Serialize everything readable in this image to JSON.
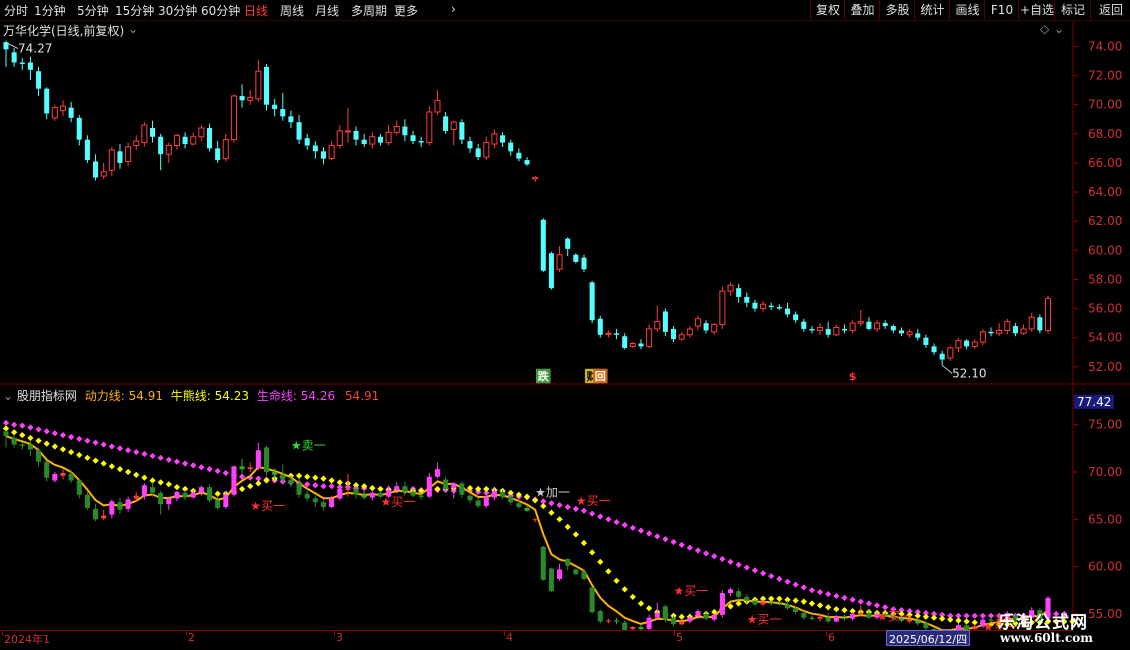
{
  "toolbar": {
    "periods": [
      "分时",
      "1分钟",
      "5分钟",
      "15分钟",
      "30分钟",
      "60分钟",
      "日线",
      "周线",
      "月线",
      "多周期",
      "更多"
    ],
    "active_period": "日线",
    "more_chevron": "›",
    "right_buttons": [
      "复权",
      "叠加",
      "多股",
      "统计",
      "画线",
      "F10",
      "+自选",
      "标记",
      "返回"
    ]
  },
  "main_chart": {
    "title": "万华化学(日线,前复权)",
    "high_label": "74.27",
    "low_label": "52.10",
    "yticks": [
      "74.00",
      "72.00",
      "70.00",
      "68.00",
      "66.00",
      "64.00",
      "62.00",
      "60.00",
      "58.00",
      "56.00",
      "54.00",
      "52.00"
    ],
    "markers": [
      "跌",
      "财",
      "回",
      "$"
    ]
  },
  "indicator": {
    "name": "股朋指标网",
    "dongli_label": "动力线:",
    "dongli_value": "54.91",
    "niuxiong_label": "牛熊线:",
    "niuxiong_value": "54.23",
    "shengming_label": "生命线:",
    "shengming_value": "54.26",
    "extra_value": "54.91",
    "yticks": [
      "75.00",
      "70.00",
      "65.00",
      "60.00",
      "55.00"
    ],
    "current_tag": "77.42",
    "signals": [
      "卖一",
      "买一",
      "买一",
      "加一",
      "买一",
      "买一",
      "买一",
      "买一",
      "买一"
    ]
  },
  "dates": {
    "labels": [
      "2024年1",
      "2",
      "3",
      "4",
      "5",
      "6"
    ],
    "cursor_date": "2025/06/12/四"
  },
  "logo": {
    "line1": "乐淘公式网",
    "line2": "www.60lt.com"
  },
  "colors": {
    "up": "#ff3c3c",
    "down": "#54ffff",
    "dongli": "#ffb000",
    "niuxiong": "#ffff00",
    "shengming": "#ff40ff",
    "axis": "#7a0000"
  },
  "chart_data": {
    "type": "candlestick",
    "ohlc": [
      [
        74.3,
        73.8,
        74.4,
        72.6
      ],
      [
        73.6,
        72.9,
        73.9,
        72.6
      ],
      [
        72.9,
        72.8,
        73.2,
        72.4
      ],
      [
        72.9,
        72.4,
        73.3,
        71.7
      ],
      [
        72.3,
        71.1,
        72.6,
        70.6
      ],
      [
        71.1,
        69.4,
        71.2,
        69.0
      ],
      [
        69.1,
        69.8,
        70.0,
        68.9
      ],
      [
        69.6,
        69.9,
        70.3,
        69.2
      ],
      [
        69.8,
        69.1,
        70.2,
        68.8
      ],
      [
        69.1,
        67.6,
        69.3,
        67.2
      ],
      [
        67.6,
        66.2,
        67.9,
        66.0
      ],
      [
        66.1,
        65.0,
        66.6,
        64.8
      ],
      [
        65.1,
        65.4,
        66.0,
        64.9
      ],
      [
        65.5,
        66.9,
        67.1,
        65.1
      ],
      [
        66.8,
        66.0,
        67.3,
        65.6
      ],
      [
        66.1,
        67.1,
        67.4,
        65.8
      ],
      [
        67.2,
        67.5,
        67.9,
        66.9
      ],
      [
        67.4,
        68.6,
        68.8,
        67.1
      ],
      [
        68.4,
        67.8,
        68.9,
        67.4
      ],
      [
        67.8,
        66.6,
        68.0,
        65.5
      ],
      [
        66.6,
        67.2,
        67.4,
        66.0
      ],
      [
        67.2,
        67.9,
        68.0,
        66.9
      ],
      [
        67.8,
        67.3,
        68.1,
        67.0
      ],
      [
        67.3,
        67.8,
        68.1,
        67.2
      ],
      [
        67.8,
        68.4,
        68.6,
        67.5
      ],
      [
        68.4,
        67.0,
        68.7,
        66.8
      ],
      [
        67.0,
        66.2,
        67.5,
        66.0
      ],
      [
        66.3,
        67.6,
        68.0,
        66.1
      ],
      [
        67.6,
        70.6,
        70.7,
        67.4
      ],
      [
        70.6,
        70.3,
        71.4,
        69.8
      ],
      [
        70.3,
        70.5,
        71.0,
        70.0
      ],
      [
        70.4,
        72.3,
        73.1,
        70.2
      ],
      [
        72.6,
        70.0,
        72.8,
        69.6
      ],
      [
        70.0,
        69.7,
        70.4,
        69.2
      ],
      [
        69.7,
        69.2,
        70.8,
        68.9
      ],
      [
        69.2,
        68.8,
        69.6,
        68.4
      ],
      [
        68.8,
        67.6,
        69.3,
        67.3
      ],
      [
        67.7,
        67.2,
        68.0,
        66.9
      ],
      [
        67.2,
        66.8,
        67.5,
        66.3
      ],
      [
        66.8,
        66.3,
        67.1,
        65.9
      ],
      [
        66.3,
        67.2,
        67.5,
        66.2
      ],
      [
        67.2,
        68.2,
        68.6,
        67.0
      ],
      [
        68.2,
        68.2,
        69.8,
        67.4
      ],
      [
        68.2,
        67.6,
        68.5,
        67.2
      ],
      [
        67.6,
        67.3,
        68.0,
        67.1
      ],
      [
        67.3,
        67.8,
        68.1,
        67.0
      ],
      [
        67.8,
        67.4,
        68.0,
        67.2
      ],
      [
        67.4,
        68.1,
        68.6,
        67.2
      ],
      [
        68.1,
        68.5,
        68.9,
        67.9
      ],
      [
        68.5,
        67.9,
        69.0,
        67.5
      ],
      [
        67.9,
        67.5,
        68.2,
        67.3
      ],
      [
        67.5,
        67.4,
        67.8,
        67.1
      ],
      [
        67.4,
        69.5,
        69.9,
        67.2
      ],
      [
        69.5,
        70.3,
        71.0,
        69.3
      ],
      [
        69.2,
        68.2,
        69.5,
        68.0
      ],
      [
        68.3,
        68.8,
        68.9,
        67.2
      ],
      [
        68.8,
        67.6,
        69.0,
        67.3
      ],
      [
        67.5,
        67.0,
        67.8,
        66.7
      ],
      [
        67.0,
        66.4,
        67.3,
        66.2
      ],
      [
        66.4,
        67.4,
        67.8,
        66.2
      ],
      [
        67.3,
        68.0,
        68.3,
        67.0
      ],
      [
        67.9,
        67.4,
        68.1,
        67.1
      ],
      [
        67.4,
        66.8,
        67.6,
        66.5
      ],
      [
        66.7,
        66.3,
        67.0,
        66.1
      ],
      [
        66.2,
        65.9,
        66.4,
        65.8
      ],
      [
        64.9,
        65.0,
        65.1,
        64.7
      ],
      [
        62.1,
        58.6,
        62.2,
        58.5
      ],
      [
        59.8,
        57.4,
        59.9,
        57.3
      ],
      [
        58.7,
        59.7,
        60.3,
        58.5
      ],
      [
        60.8,
        60.1,
        60.9,
        59.6
      ],
      [
        59.7,
        59.2,
        59.8,
        59.1
      ],
      [
        59.5,
        58.7,
        59.7,
        58.5
      ],
      [
        57.8,
        55.2,
        57.9,
        55.0
      ],
      [
        55.3,
        54.2,
        55.5,
        54.0
      ],
      [
        54.3,
        54.3,
        54.5,
        54.0
      ],
      [
        54.3,
        54.2,
        54.6,
        53.9
      ],
      [
        54.1,
        53.3,
        54.3,
        53.2
      ],
      [
        53.4,
        53.6,
        53.7,
        53.3
      ],
      [
        53.6,
        53.4,
        53.9,
        53.2
      ],
      [
        53.4,
        54.6,
        54.9,
        53.3
      ],
      [
        54.6,
        55.1,
        56.2,
        54.4
      ],
      [
        55.8,
        54.4,
        56.0,
        54.1
      ],
      [
        54.6,
        53.9,
        54.8,
        53.7
      ],
      [
        53.9,
        54.2,
        54.4,
        53.8
      ],
      [
        54.2,
        54.6,
        54.8,
        54.0
      ],
      [
        54.8,
        55.3,
        55.5,
        54.5
      ],
      [
        55.0,
        54.5,
        55.2,
        54.3
      ],
      [
        54.4,
        54.9,
        55.0,
        54.2
      ],
      [
        54.9,
        57.2,
        57.5,
        54.6
      ],
      [
        57.2,
        57.6,
        57.8,
        56.9
      ],
      [
        57.4,
        56.8,
        57.7,
        56.4
      ],
      [
        56.8,
        56.4,
        57.1,
        56.1
      ],
      [
        56.4,
        56.0,
        56.6,
        55.8
      ],
      [
        56.0,
        56.3,
        56.5,
        55.8
      ],
      [
        56.2,
        56.1,
        56.4,
        55.9
      ],
      [
        56.1,
        56.0,
        56.3,
        55.9
      ],
      [
        56.0,
        55.6,
        56.4,
        55.4
      ],
      [
        55.6,
        55.2,
        55.8,
        55.0
      ],
      [
        55.1,
        54.6,
        55.3,
        54.4
      ],
      [
        54.6,
        54.5,
        54.8,
        54.3
      ],
      [
        54.5,
        54.7,
        55.0,
        54.2
      ],
      [
        54.6,
        54.2,
        55.1,
        54.0
      ],
      [
        54.2,
        54.7,
        54.9,
        54.1
      ],
      [
        54.6,
        54.5,
        54.9,
        54.3
      ],
      [
        54.5,
        55.0,
        55.2,
        54.3
      ],
      [
        55.0,
        55.1,
        55.9,
        54.8
      ],
      [
        55.1,
        54.6,
        55.4,
        54.5
      ],
      [
        54.6,
        55.0,
        55.2,
        54.4
      ],
      [
        55.0,
        54.8,
        55.2,
        54.6
      ],
      [
        54.8,
        54.5,
        54.9,
        54.3
      ],
      [
        54.5,
        54.3,
        54.7,
        54.1
      ],
      [
        54.2,
        54.4,
        54.6,
        54.0
      ],
      [
        54.3,
        54.0,
        54.6,
        53.8
      ],
      [
        54.0,
        53.5,
        54.2,
        53.3
      ],
      [
        53.4,
        53.0,
        53.6,
        52.8
      ],
      [
        52.9,
        52.5,
        53.1,
        52.1
      ],
      [
        52.6,
        53.3,
        53.4,
        52.4
      ],
      [
        53.3,
        53.8,
        54.0,
        53.0
      ],
      [
        53.8,
        53.4,
        53.9,
        53.2
      ],
      [
        53.4,
        53.7,
        53.9,
        53.2
      ],
      [
        53.7,
        54.4,
        54.6,
        53.5
      ],
      [
        54.4,
        54.3,
        54.7,
        54.1
      ],
      [
        54.3,
        54.5,
        55.0,
        54.1
      ],
      [
        54.5,
        55.1,
        55.3,
        54.2
      ],
      [
        54.8,
        54.3,
        55.0,
        54.1
      ],
      [
        54.3,
        54.6,
        54.9,
        54.2
      ],
      [
        54.6,
        55.4,
        55.7,
        54.4
      ],
      [
        55.4,
        54.5,
        55.6,
        54.3
      ],
      [
        54.5,
        56.7,
        56.9,
        54.3
      ]
    ],
    "ylim": [
      51.3,
      75.2
    ],
    "indicator_ylim": [
      53.3,
      77.4
    ],
    "niuxiong": [
      74.6,
      74.2,
      73.9,
      73.6,
      73.3,
      73.0,
      72.7,
      72.4,
      72.1,
      71.8,
      71.5,
      71.2,
      70.9,
      70.6,
      70.3,
      70.0,
      69.7,
      69.4,
      69.1,
      68.9,
      68.7,
      68.4,
      68.2,
      68.0,
      67.9,
      67.8,
      67.7,
      67.7,
      67.9,
      68.2,
      68.5,
      68.8,
      69.1,
      69.3,
      69.5,
      69.6,
      69.6,
      69.5,
      69.4,
      69.3,
      69.1,
      68.9,
      68.8,
      68.6,
      68.5,
      68.3,
      68.2,
      68.1,
      68.1,
      68.0,
      68.0,
      68.0,
      68.1,
      68.2,
      68.3,
      68.3,
      68.3,
      68.3,
      68.2,
      68.2,
      68.1,
      68.0,
      67.8,
      67.6,
      67.4,
      67.0,
      66.4,
      65.7,
      65.0,
      64.2,
      63.4,
      62.5,
      61.5,
      60.5,
      59.5,
      58.5,
      57.6,
      56.8,
      56.1,
      55.6,
      55.2,
      55.0,
      54.8,
      54.7,
      54.7,
      54.8,
      55.0,
      55.2,
      55.5,
      55.8,
      56.1,
      56.3,
      56.5,
      56.6,
      56.6,
      56.6,
      56.5,
      56.4,
      56.3,
      56.1,
      55.9,
      55.7,
      55.5,
      55.4,
      55.3,
      55.2,
      55.2,
      55.1,
      55.1,
      55.0,
      55.0,
      54.9,
      54.8,
      54.7,
      54.6,
      54.5,
      54.4,
      54.3,
      54.2,
      54.1,
      54.0,
      53.9,
      53.9,
      53.9,
      54.0,
      54.0,
      54.1,
      54.1,
      54.2,
      54.2,
      54.2,
      54.2
    ],
    "shengming": [
      75.2,
      75.0,
      74.9,
      74.7,
      74.5,
      74.3,
      74.1,
      73.9,
      73.7,
      73.5,
      73.3,
      73.1,
      72.9,
      72.7,
      72.5,
      72.3,
      72.1,
      71.9,
      71.7,
      71.5,
      71.3,
      71.1,
      70.9,
      70.7,
      70.5,
      70.3,
      70.1,
      69.9,
      69.7,
      69.5,
      69.4,
      69.3,
      69.2,
      69.1,
      69.0,
      68.9,
      68.8,
      68.7,
      68.6,
      68.5,
      68.5,
      68.4,
      68.4,
      68.3,
      68.3,
      68.3,
      68.2,
      68.2,
      68.2,
      68.2,
      68.2,
      68.1,
      68.1,
      68.1,
      68.1,
      68.0,
      68.0,
      68.0,
      67.9,
      67.8,
      67.7,
      67.6,
      67.5,
      67.4,
      67.3,
      67.1,
      66.9,
      66.7,
      66.5,
      66.3,
      66.1,
      65.9,
      65.6,
      65.3,
      65.0,
      64.7,
      64.4,
      64.1,
      63.8,
      63.5,
      63.2,
      62.9,
      62.6,
      62.3,
      62.0,
      61.7,
      61.4,
      61.1,
      60.8,
      60.5,
      60.2,
      59.9,
      59.6,
      59.3,
      59.0,
      58.7,
      58.4,
      58.1,
      57.8,
      57.5,
      57.3,
      57.1,
      56.9,
      56.7,
      56.5,
      56.3,
      56.1,
      55.9,
      55.7,
      55.5,
      55.4,
      55.3,
      55.2,
      55.1,
      55.0,
      54.9,
      54.8,
      54.8,
      54.8,
      54.8,
      54.8,
      54.8,
      54.8,
      54.8,
      54.8,
      54.8,
      54.9,
      54.9,
      54.9,
      55.0,
      55.0
    ]
  }
}
